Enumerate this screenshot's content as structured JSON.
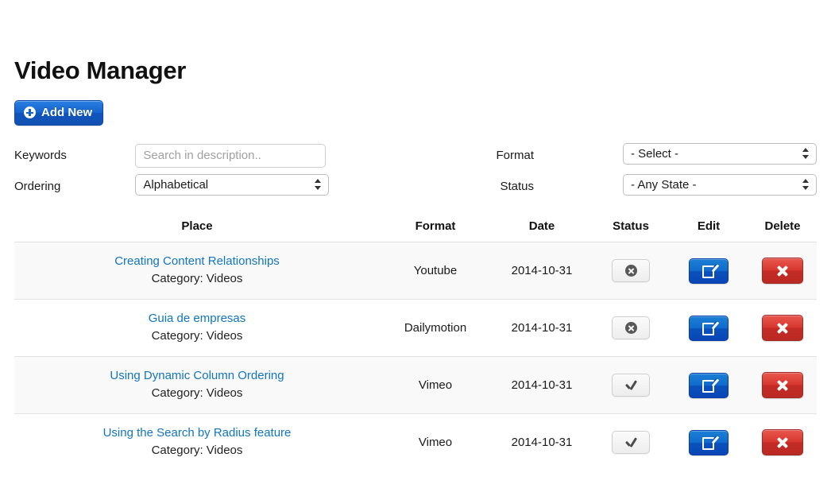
{
  "page": {
    "title": "Video Manager"
  },
  "toolbar": {
    "add_new_label": "Add New",
    "add_new_icon": "circle-plus-icon"
  },
  "filters": {
    "keywords": {
      "label": "Keywords",
      "value": "",
      "placeholder": "Search in description.."
    },
    "ordering": {
      "label": "Ordering",
      "value": "Alphabetical"
    },
    "format": {
      "label": "Format",
      "value": "- Select -"
    },
    "status": {
      "label": "Status",
      "value": "- Any State -"
    }
  },
  "table": {
    "columns": {
      "place": "Place",
      "format": "Format",
      "date": "Date",
      "status": "Status",
      "edit": "Edit",
      "delete": "Delete"
    },
    "rows": [
      {
        "title": "Creating Content Relationships",
        "category": "Category: Videos",
        "format": "Youtube",
        "date": "2014-10-31",
        "status_icon": "x-circle-icon",
        "edit_icon": "pencil-square-icon",
        "delete_icon": "x-bold-icon"
      },
      {
        "title": "Guia de empresas",
        "category": "Category: Videos",
        "format": "Dailymotion",
        "date": "2014-10-31",
        "status_icon": "x-circle-icon",
        "edit_icon": "pencil-square-icon",
        "delete_icon": "x-bold-icon"
      },
      {
        "title": "Using Dynamic Column Ordering",
        "category": "Category: Videos",
        "format": "Vimeo",
        "date": "2014-10-31",
        "status_icon": "check-icon",
        "edit_icon": "pencil-square-icon",
        "delete_icon": "x-bold-icon"
      },
      {
        "title": "Using the Search by Radius feature",
        "category": "Category: Videos",
        "format": "Vimeo",
        "date": "2014-10-31",
        "status_icon": "check-icon",
        "edit_icon": "pencil-square-icon",
        "delete_icon": "x-bold-icon"
      }
    ]
  },
  "colors": {
    "primary_blue": "#1463cf",
    "link_blue": "#1175c0",
    "danger_red": "#d8372f",
    "row_stripe": "#f9f9f9",
    "border_gray": "#e2e2e2"
  }
}
